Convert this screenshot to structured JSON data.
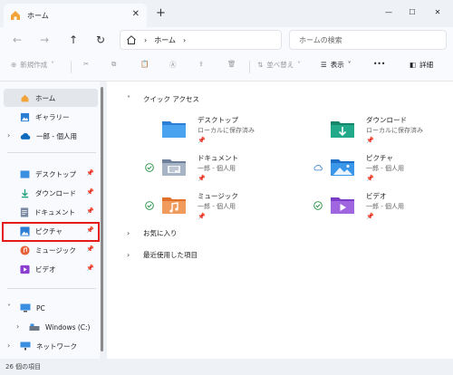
{
  "window": {
    "tab_title": "ホーム",
    "new_tab": "+",
    "tab_close": "✕",
    "min": "—",
    "max": "☐",
    "close": "✕"
  },
  "address": {
    "segment": "ホーム",
    "separator": "›",
    "search_placeholder": "ホームの検索"
  },
  "toolbar": {
    "new_label": "新規作成",
    "sort_label": "並べ替え",
    "view_label": "表示",
    "more_label": "•••",
    "details_label": "詳細"
  },
  "sidebar": {
    "home": "ホーム",
    "gallery": "ギャラリー",
    "onedrive": "一郎 - 個人用",
    "pinned": [
      {
        "label": "デスクトップ"
      },
      {
        "label": "ダウンロード"
      },
      {
        "label": "ドキュメント"
      },
      {
        "label": "ピクチャ"
      },
      {
        "label": "ミュージック"
      },
      {
        "label": "ビデオ"
      }
    ],
    "pc": "PC",
    "drive": "Windows (C:)",
    "network": "ネットワーク"
  },
  "main": {
    "quick_access_title": "クイック アクセス",
    "favorites_title": "お気に入り",
    "recent_title": "最近使用した項目",
    "items": [
      {
        "name": "デスクトップ",
        "sub": "ローカルに保存済み"
      },
      {
        "name": "ダウンロード",
        "sub": "ローカルに保存済み"
      },
      {
        "name": "ドキュメント",
        "sub": "一郎 - 個人用"
      },
      {
        "name": "ピクチャ",
        "sub": "一郎 - 個人用"
      },
      {
        "name": "ミュージック",
        "sub": "一郎 - 個人用"
      },
      {
        "name": "ビデオ",
        "sub": "一郎 - 個人用"
      }
    ]
  },
  "status": {
    "count": "26 個の項目"
  },
  "colors": {
    "accent": "#0067c0",
    "highlight": "#e3191b",
    "check_green": "#1e8e3e"
  }
}
